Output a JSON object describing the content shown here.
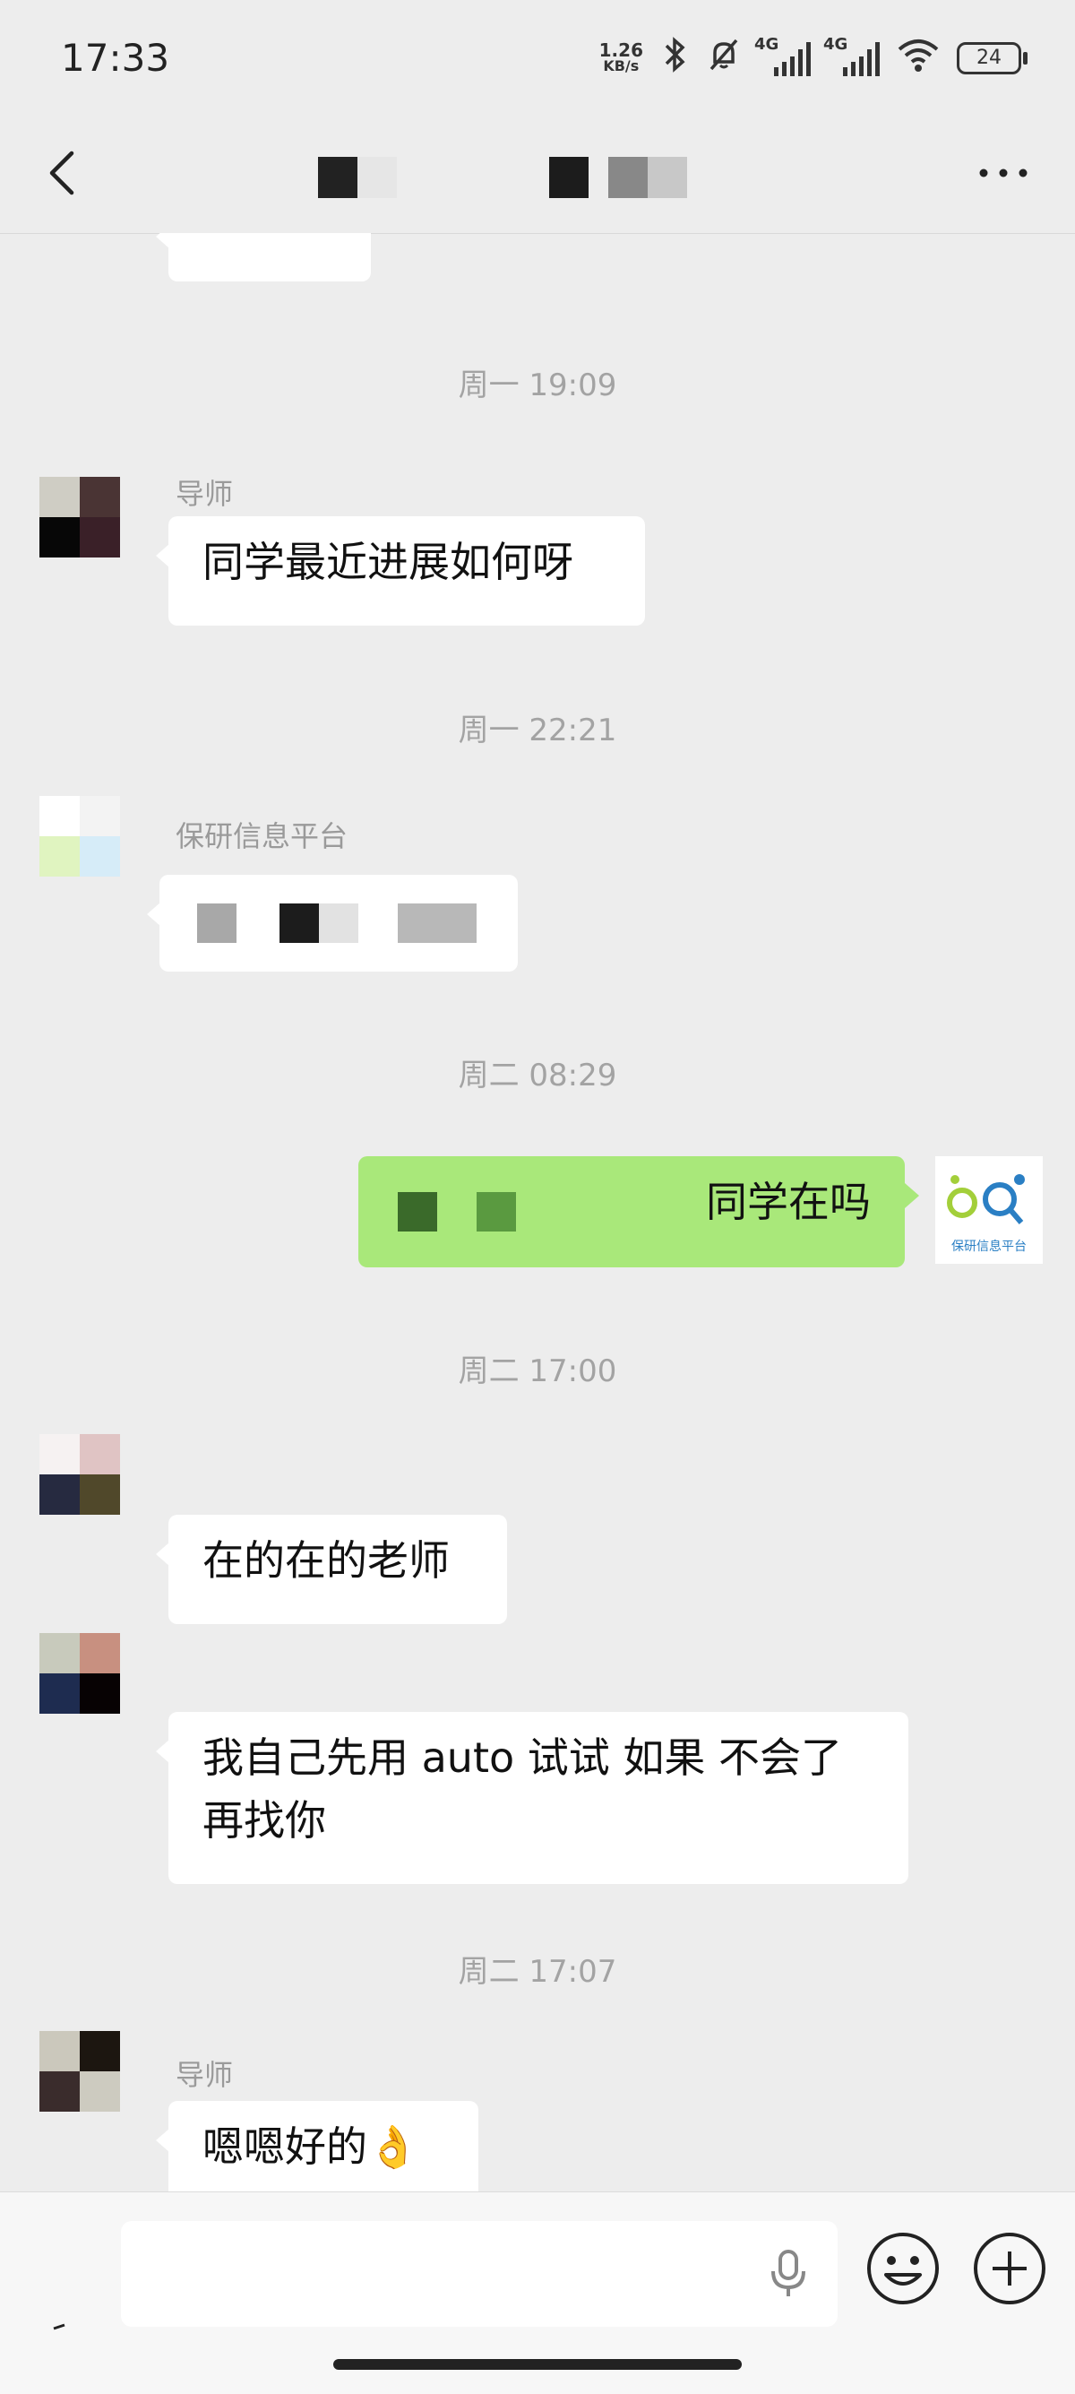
{
  "status_bar": {
    "time": "17:33",
    "net_speed": "1.26",
    "net_unit": "KB/s",
    "net_type_1": "4G",
    "net_type_2": "4G",
    "battery": "24",
    "icons": [
      "bluetooth-icon",
      "mute-icon",
      "signal-icon",
      "signal-icon",
      "wifi-icon",
      "battery-icon"
    ]
  },
  "header": {
    "back_icon": "chevron-left-icon",
    "more_icon": "more-dots-icon"
  },
  "messages": {
    "ts1": "周一 19:09",
    "msg1": {
      "sender": "导师",
      "text": "同学最近进展如何呀"
    },
    "ts2": "周一 22:21",
    "msg2": {
      "sender": "保研信息平台"
    },
    "ts3": "周二 08:29",
    "msg3": {
      "text": "同学在吗",
      "avatar_label": "保研信息平台"
    },
    "ts4": "周二 17:00",
    "msg4": {
      "text": "在的在的老师"
    },
    "msg5": {
      "text_line1": "我自己先用 auto 试试 如果 不会了",
      "text_line2": "再找你"
    },
    "ts5": "周二 17:07",
    "msg6": {
      "sender": "导师",
      "text": "嗯嗯好的",
      "emoji": "👌"
    }
  },
  "input": {
    "placeholder": "",
    "icons": [
      "voice-icon",
      "mic-icon",
      "emoji-icon",
      "plus-icon"
    ]
  }
}
